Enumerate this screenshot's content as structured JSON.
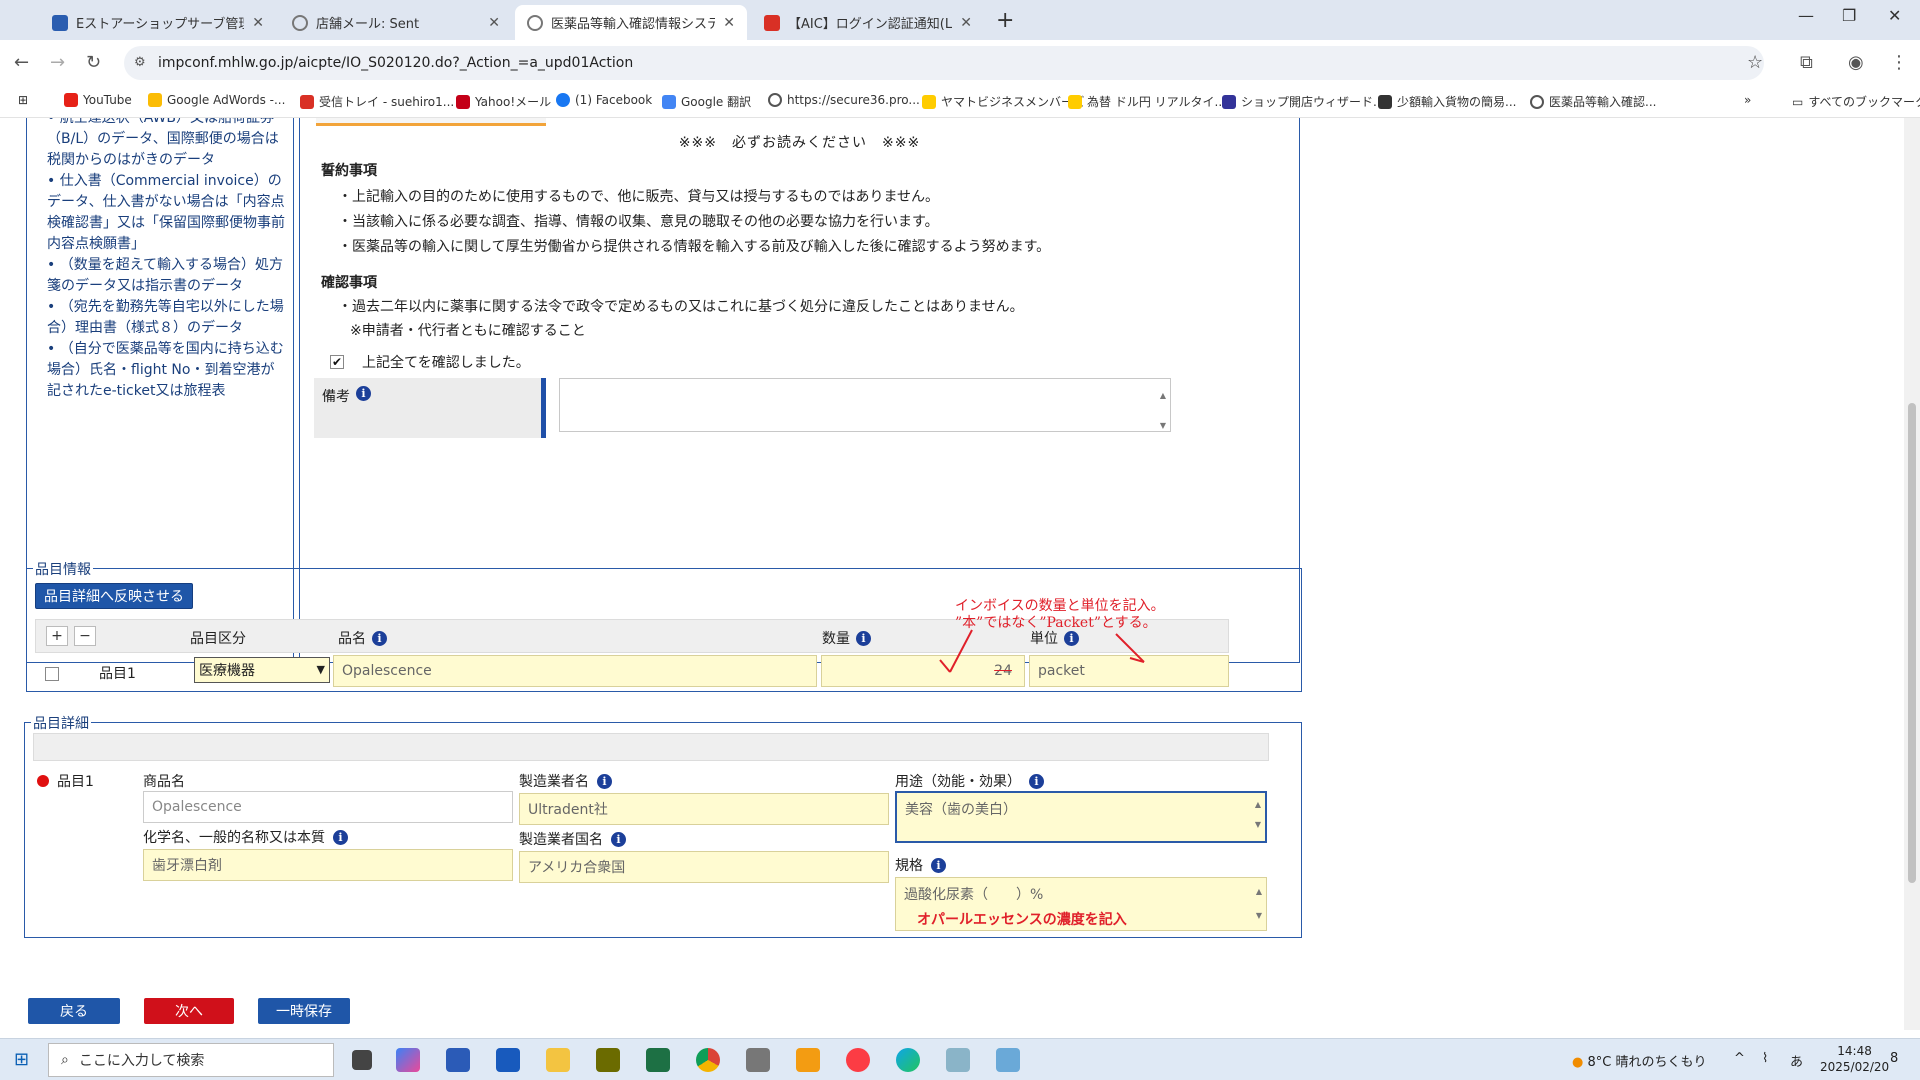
{
  "browser": {
    "tabs": [
      {
        "title": "Eストアーショップサーブ管理画面",
        "color": "#2a5db0"
      },
      {
        "title": "店舗メール: Sent",
        "color": "#777777"
      },
      {
        "title": "医薬品等輸入確認情報システム[F",
        "color": "#777777"
      },
      {
        "title": "【AIC】ログイン認証通知(Login Au",
        "color": "#d93025"
      }
    ],
    "url": "impconf.mhlw.go.jp/aicpte/IO_S020120.do?_Action_=a_upd01Action",
    "bookmarks": [
      {
        "label": "YouTube",
        "color": "#e62117"
      },
      {
        "label": "Google AdWords -...",
        "color": "#fbbc05"
      },
      {
        "label": "受信トレイ - suehiro1...",
        "color": "#d93025"
      },
      {
        "label": "Yahoo!メール",
        "color": "#c40018"
      },
      {
        "label": "(1) Facebook",
        "color": "#1877f2"
      },
      {
        "label": "Google 翻訳",
        "color": "#4285f4"
      },
      {
        "label": "https://secure36.pro...",
        "color": "#555555"
      },
      {
        "label": "ヤマトビジネスメンバーズ",
        "color": "#ffcc00"
      },
      {
        "label": "為替 ドル円 リアルタイ...",
        "color": "#ffcc00"
      },
      {
        "label": "ショップ開店ウィザード...",
        "color": "#333399"
      },
      {
        "label": "少額輸入貨物の簡易...",
        "color": "#333333"
      },
      {
        "label": "医薬品等輸入確認...",
        "color": "#555555"
      }
    ],
    "all_bookmarks": "すべてのブックマーク"
  },
  "left_panel": {
    "lines": [
      "• 航空運送状（AWB）又は船荷証券（B/L）のデータ、国際郵便の場合は税関からのはがきのデータ",
      "• 仕入書（Commercial invoice）のデータ、仕入書がない場合は「内容点検確認書」又は「保留国際郵便物事前内容点検願書」",
      "• （数量を超えて輸入する場合）処方箋のデータ又は指示書のデータ",
      "• （宛先を勤務先等自宅以外にした場合）理由書（様式８）のデータ",
      "• （自分で医薬品等を国内に持ち込む場合）氏名・flight No・到着空港が記されたe-ticket又は旅程表"
    ]
  },
  "notice": {
    "read_me": "※※※　必ずお読みください　※※※",
    "pledge_title": "誓約事項",
    "pledge_lines": [
      "・上記輸入の目的のために使用するもので、他に販売、貸与又は授与するものではありません。",
      "・当該輸入に係る必要な調査、指導、情報の収集、意見の聴取その他の必要な協力を行います。",
      "・医薬品等の輸入に関して厚生労働省から提供される情報を輸入する前及び輸入した後に確認するよう努めます。"
    ],
    "confirm_title": "確認事項",
    "confirm_lines": [
      "・過去二年以内に薬事に関する法令で政令で定めるもの又はこれに基づく処分に違反したことはありません。",
      "※申請者・代行者ともに確認すること"
    ],
    "confirm_check": "上記全てを確認しました。",
    "remarks_label": "備考"
  },
  "item_info": {
    "title": "品目情報",
    "reflect_button": "品目詳細へ反映させる",
    "plus": "+",
    "minus": "−",
    "col_category": "品目区分",
    "col_name": "品名",
    "col_qty": "数量",
    "col_unit": "単位",
    "row_label": "品目1",
    "category_value": "医療機器",
    "name_value": "Opalescence",
    "qty_value": "24",
    "unit_value": "packet",
    "annotation_line1": "インボイスの数量と単位を記入。",
    "annotation_line2": "”本”ではなく”Packet”とする。"
  },
  "item_detail": {
    "title": "品目詳細",
    "row_label": "品目1",
    "product_name_label": "商品名",
    "product_name_value": "Opalescence",
    "manufacturer_label": "製造業者名",
    "manufacturer_value": "Ultradent社",
    "usage_label": "用途（効能・効果）",
    "usage_value": "美容（歯の美白）",
    "chem_label": "化学名、一般的名称又は本質",
    "chem_value": "歯牙漂白剤",
    "country_label": "製造業者国名",
    "country_value": "アメリカ合衆国",
    "spec_label": "規格",
    "spec_value": "過酸化尿素（　　）%",
    "spec_note": "オパールエッセンスの濃度を記入"
  },
  "footer_buttons": {
    "back": "戻る",
    "next": "次へ",
    "save": "一時保存"
  },
  "taskbar": {
    "search_placeholder": "ここに入力して検索",
    "weather": "8°C  晴れのちくもり",
    "time": "14:48",
    "date": "2025/02/20",
    "ime": "あ",
    "notif_count": "8"
  }
}
